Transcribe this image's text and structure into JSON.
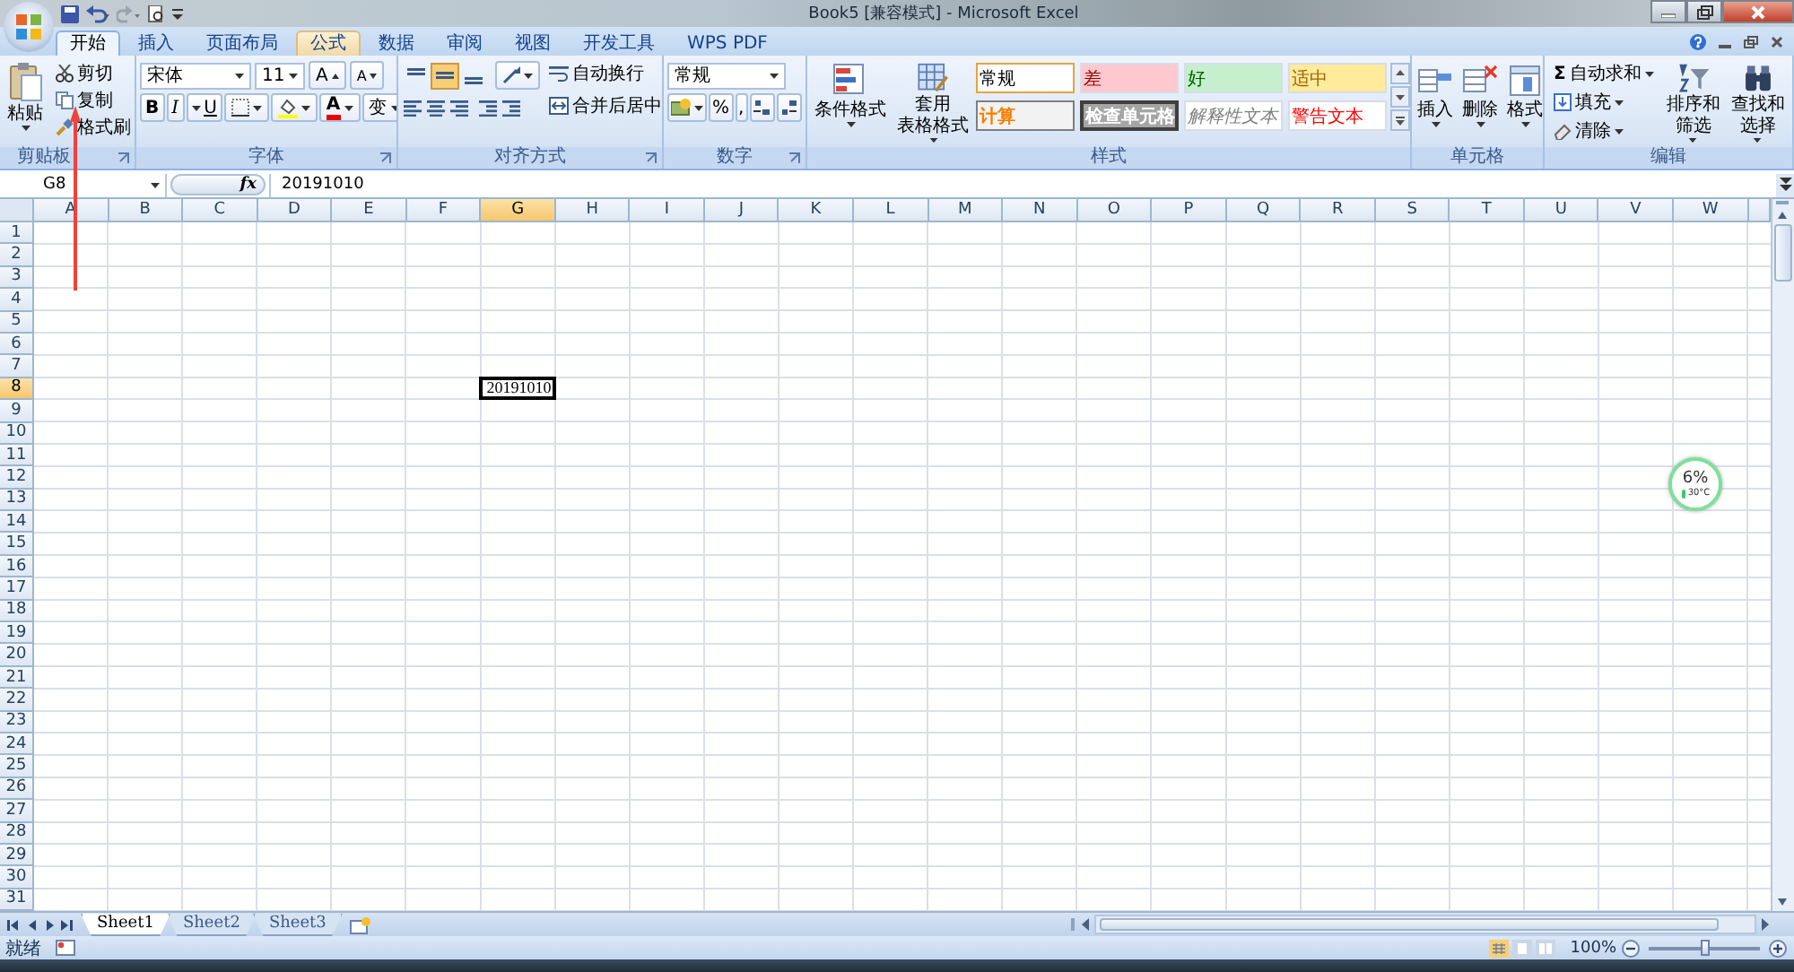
{
  "window": {
    "title": "Book5  [兼容模式] - Microsoft Excel"
  },
  "tabs": [
    {
      "label": "开始",
      "selected": true,
      "hovered": false
    },
    {
      "label": "插入",
      "selected": false,
      "hovered": false
    },
    {
      "label": "页面布局",
      "selected": false,
      "hovered": false
    },
    {
      "label": "公式",
      "selected": false,
      "hovered": true
    },
    {
      "label": "数据",
      "selected": false,
      "hovered": false
    },
    {
      "label": "审阅",
      "selected": false,
      "hovered": false
    },
    {
      "label": "视图",
      "selected": false,
      "hovered": false
    },
    {
      "label": "开发工具",
      "selected": false,
      "hovered": false
    },
    {
      "label": "WPS PDF",
      "selected": false,
      "hovered": false
    }
  ],
  "ribbon": {
    "clipboard": {
      "label": "剪贴板",
      "paste": "粘贴",
      "items": [
        "剪切",
        "复制",
        "格式刷"
      ]
    },
    "font": {
      "label": "字体",
      "font_name": "宋体",
      "font_size": "11",
      "grow": "A",
      "shrink": "A",
      "styles": [
        "B",
        "I",
        "U"
      ],
      "font_color": "A",
      "phonetic": "变"
    },
    "alignment": {
      "label": "对齐方式",
      "vertical": [
        {
          "selected": false
        },
        {
          "selected": true
        },
        {
          "selected": false
        }
      ],
      "wrap": "自动换行",
      "merge": "合并后居中"
    },
    "number": {
      "label": "数字",
      "format": "常规",
      "percent": "%",
      "comma": ","
    },
    "styles": {
      "label": "样式",
      "conditional": "条件格式",
      "table_format": [
        "套用",
        "表格格式"
      ],
      "cell_styles": [
        {
          "label": "常规",
          "kind": "normal",
          "color": "#ffffff"
        },
        {
          "label": "差",
          "kind": "bad",
          "color": "#ffc7ce"
        },
        {
          "label": "好",
          "kind": "good",
          "color": "#c6efce"
        },
        {
          "label": "适中",
          "kind": "neutral",
          "color": "#ffeb9c"
        },
        {
          "label": "计算",
          "kind": "calc",
          "color": "#f2f2f2"
        },
        {
          "label": "检查单元格",
          "kind": "check",
          "color": "#a5a5a5"
        },
        {
          "label": "解释性文本",
          "kind": "note",
          "color": "#ffffff"
        },
        {
          "label": "警告文本",
          "kind": "warning",
          "color": "#ffffff"
        }
      ]
    },
    "cells": {
      "label": "单元格",
      "items": [
        "插入",
        "删除",
        "格式"
      ]
    },
    "editing": {
      "label": "编辑",
      "sum_symbol": "Σ",
      "items": [
        "自动求和",
        "填充",
        "清除"
      ],
      "big": [
        [
          "排序和",
          "筛选"
        ],
        [
          "查找和",
          "选择"
        ]
      ]
    }
  },
  "formula_bar": {
    "name_box": "G8",
    "function_label": "fx",
    "value": "20191010"
  },
  "columns": [
    {
      "label": "A",
      "selected": false
    },
    {
      "label": "B",
      "selected": false
    },
    {
      "label": "C",
      "selected": false
    },
    {
      "label": "D",
      "selected": false
    },
    {
      "label": "E",
      "selected": false
    },
    {
      "label": "F",
      "selected": false
    },
    {
      "label": "G",
      "selected": true
    },
    {
      "label": "H",
      "selected": false
    },
    {
      "label": "I",
      "selected": false
    },
    {
      "label": "J",
      "selected": false
    },
    {
      "label": "K",
      "selected": false
    },
    {
      "label": "L",
      "selected": false
    },
    {
      "label": "M",
      "selected": false
    },
    {
      "label": "N",
      "selected": false
    },
    {
      "label": "O",
      "selected": false
    },
    {
      "label": "P",
      "selected": false
    },
    {
      "label": "Q",
      "selected": false
    },
    {
      "label": "R",
      "selected": false
    },
    {
      "label": "S",
      "selected": false
    },
    {
      "label": "T",
      "selected": false
    },
    {
      "label": "U",
      "selected": false
    },
    {
      "label": "V",
      "selected": false
    },
    {
      "label": "W",
      "selected": false
    }
  ],
  "rows": [
    {
      "label": "1",
      "selected": false
    },
    {
      "label": "2",
      "selected": false
    },
    {
      "label": "3",
      "selected": false
    },
    {
      "label": "4",
      "selected": false
    },
    {
      "label": "5",
      "selected": false
    },
    {
      "label": "6",
      "selected": false
    },
    {
      "label": "7",
      "selected": false
    },
    {
      "label": "8",
      "selected": true,
      "active_value": "20191010"
    },
    {
      "label": "9",
      "selected": false
    },
    {
      "label": "10",
      "selected": false
    },
    {
      "label": "11",
      "selected": false
    },
    {
      "label": "12",
      "selected": false
    },
    {
      "label": "13",
      "selected": false
    },
    {
      "label": "14",
      "selected": false
    },
    {
      "label": "15",
      "selected": false
    },
    {
      "label": "16",
      "selected": false
    },
    {
      "label": "17",
      "selected": false
    },
    {
      "label": "18",
      "selected": false
    },
    {
      "label": "19",
      "selected": false
    },
    {
      "label": "20",
      "selected": false
    },
    {
      "label": "21",
      "selected": false
    },
    {
      "label": "22",
      "selected": false
    },
    {
      "label": "23",
      "selected": false
    },
    {
      "label": "24",
      "selected": false
    },
    {
      "label": "25",
      "selected": false
    },
    {
      "label": "26",
      "selected": false
    },
    {
      "label": "27",
      "selected": false
    },
    {
      "label": "28",
      "selected": false
    },
    {
      "label": "29",
      "selected": false
    },
    {
      "label": "30",
      "selected": false
    },
    {
      "label": "31",
      "selected": false
    }
  ],
  "sheets": [
    {
      "label": "Sheet1",
      "selected": true
    },
    {
      "label": "Sheet2",
      "selected": false
    },
    {
      "label": "Sheet3",
      "selected": false
    }
  ],
  "status_bar": {
    "status": "就绪",
    "zoom": "100%",
    "zoom_slider": {
      "level": 0.5
    }
  },
  "widget": {
    "value": "6%",
    "temperature": "30°C"
  }
}
